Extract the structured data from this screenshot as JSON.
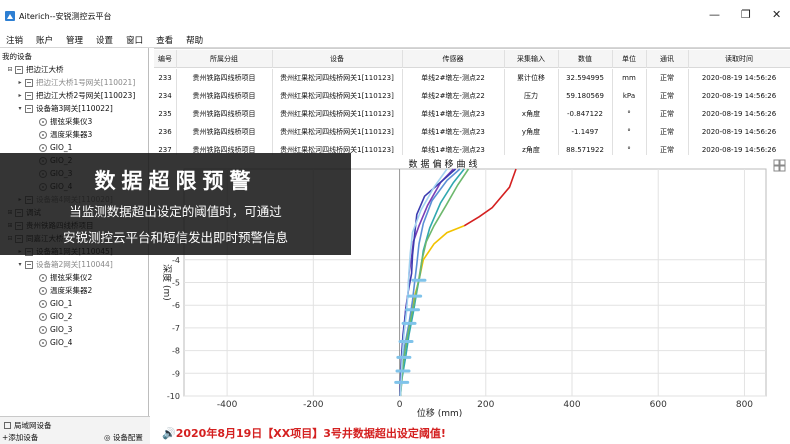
{
  "window": {
    "title": "Aiterich--安锐测控云平台",
    "controls": {
      "minimize": "—",
      "restore": "❐",
      "close": "✕"
    }
  },
  "menu": [
    "注销",
    "账户",
    "管理",
    "设置",
    "窗口",
    "查看",
    "帮助"
  ],
  "tree": {
    "root": "我的设备",
    "nodes": [
      {
        "label": "把边江大桥",
        "level": 1,
        "icon": "folder-icon",
        "toggle": "⊟"
      },
      {
        "label": "把边江大桥1号网关[110021]",
        "level": 2,
        "icon": "folder-icon",
        "toggle": "▸",
        "faded": true
      },
      {
        "label": "把边江大桥2号网关[110023]",
        "level": 2,
        "icon": "folder-icon",
        "toggle": "▸"
      },
      {
        "label": "设备箱3网关[110022]",
        "level": 2,
        "icon": "folder-icon",
        "toggle": "▾"
      },
      {
        "label": "振弦采集仪3",
        "level": 3,
        "icon": "gauge-icon"
      },
      {
        "label": "温度采集器3",
        "level": 3,
        "icon": "gauge-icon"
      },
      {
        "label": "GIO_1",
        "level": 3,
        "icon": "gauge-icon"
      },
      {
        "label": "GIO_2",
        "level": 3,
        "icon": "gauge-icon"
      },
      {
        "label": "GIO_3",
        "level": 3,
        "icon": "gauge-icon"
      },
      {
        "label": "GIO_4",
        "level": 3,
        "icon": "gauge-icon"
      },
      {
        "label": "设备箱4网关[110020]",
        "level": 2,
        "icon": "folder-icon",
        "toggle": "▸",
        "faded": true
      },
      {
        "label": "调试",
        "level": 1,
        "icon": "folder-icon",
        "toggle": "⊞"
      },
      {
        "label": "贵州铁路四线桥项目",
        "level": 1,
        "icon": "folder-icon",
        "toggle": "⊞"
      },
      {
        "label": "同嘉江大桥",
        "level": 1,
        "icon": "folder-icon",
        "toggle": "⊟"
      },
      {
        "label": "设备箱1网关[110045]",
        "level": 2,
        "icon": "folder-icon",
        "toggle": "▸"
      },
      {
        "label": "设备箱2网关[110044]",
        "level": 2,
        "icon": "folder-icon",
        "toggle": "▾",
        "faded": true
      },
      {
        "label": "振弦采集仪2",
        "level": 3,
        "icon": "gauge-icon"
      },
      {
        "label": "温度采集器2",
        "level": 3,
        "icon": "gauge-icon"
      },
      {
        "label": "GIO_1",
        "level": 3,
        "icon": "gauge-icon"
      },
      {
        "label": "GIO_2",
        "level": 3,
        "icon": "gauge-icon"
      },
      {
        "label": "GIO_3",
        "level": 3,
        "icon": "gauge-icon"
      },
      {
        "label": "GIO_4",
        "level": 3,
        "icon": "gauge-icon"
      }
    ]
  },
  "bottom_tabs": {
    "network": "局域网设备",
    "add_device": "+添加设备",
    "device_config": "◎ 设备配置"
  },
  "table": {
    "headers": [
      "编号",
      "所属分组",
      "设备",
      "传感器",
      "采集输入",
      "数值",
      "单位",
      "通讯",
      "读取时间"
    ],
    "rows": [
      [
        "233",
        "贵州铁路四线桥项目",
        "贵州红果松河四线桥网关1[110123]",
        "单线2#墩左-测点22",
        "累计位移",
        "32.594995",
        "mm",
        "正常",
        "2020-08-19 14:56:26"
      ],
      [
        "234",
        "贵州铁路四线桥项目",
        "贵州红果松河四线桥网关1[110123]",
        "单线2#墩左-测点22",
        "压力",
        "59.180569",
        "kPa",
        "正常",
        "2020-08-19 14:56:26"
      ],
      [
        "235",
        "贵州铁路四线桥项目",
        "贵州红果松河四线桥网关1[110123]",
        "单线1#墩左-测点23",
        "x角度",
        "-0.847122",
        "°",
        "正常",
        "2020-08-19 14:56:26"
      ],
      [
        "236",
        "贵州铁路四线桥项目",
        "贵州红果松河四线桥网关1[110123]",
        "单线1#墩左-测点23",
        "y角度",
        "-1.1497",
        "°",
        "正常",
        "2020-08-19 14:56:26"
      ],
      [
        "237",
        "贵州铁路四线桥项目",
        "贵州红果松河四线桥网关1[110123]",
        "单线1#墩左-测点23",
        "z角度",
        "88.571922",
        "°",
        "正常",
        "2020-08-19 14:56:26"
      ]
    ]
  },
  "overlay": {
    "headline": "数据超限预警",
    "line1": "当监测数据超出设定的阈值时，可通过",
    "line2": "安锐测控云平台和短信发出即时预警信息"
  },
  "alarm": {
    "prefix": "🔊",
    "text": "2020年8月19日【XX项目】3号井数据超出设定阈值!"
  },
  "chart_data": {
    "type": "line",
    "title": "数据偏移曲线",
    "xlabel": "位移 (mm)",
    "ylabel": "深度 (m)",
    "xlim": [
      -500,
      310
    ],
    "ylim": [
      -10,
      0
    ],
    "xticks": [
      -400,
      -200,
      0,
      200,
      400,
      600,
      800
    ],
    "yticks": [
      -4,
      -5,
      -6,
      -7,
      -8,
      -9,
      -10
    ],
    "series": [
      {
        "color": "#d42020",
        "points": [
          [
            270,
            0
          ],
          [
            255,
            -0.8
          ],
          [
            215,
            -1.7
          ],
          [
            185,
            -2.1
          ],
          [
            150,
            -2.5
          ]
        ]
      },
      {
        "color": "#f2c200",
        "points": [
          [
            150,
            -2.5
          ],
          [
            110,
            -2.8
          ],
          [
            80,
            -3.3
          ],
          [
            55,
            -4.0
          ],
          [
            45,
            -4.9
          ],
          [
            35,
            -5.6
          ],
          [
            28,
            -6.4
          ],
          [
            20,
            -7.3
          ],
          [
            10,
            -8.2
          ],
          [
            5,
            -9.1
          ],
          [
            2,
            -10
          ]
        ]
      },
      {
        "color": "#7a3fb8",
        "points": [
          [
            125,
            0
          ],
          [
            95,
            -0.6
          ],
          [
            65,
            -1.6
          ],
          [
            45,
            -2.5
          ],
          [
            32,
            -3.2
          ],
          [
            28,
            -3.9
          ],
          [
            22,
            -4.6
          ],
          [
            20,
            -5.4
          ],
          [
            14,
            -6.2
          ],
          [
            10,
            -7.2
          ],
          [
            5,
            -8.3
          ],
          [
            2,
            -10
          ]
        ]
      },
      {
        "color": "#5b8fd6",
        "points": [
          [
            140,
            0
          ],
          [
            110,
            -0.5
          ],
          [
            75,
            -1.4
          ],
          [
            55,
            -2.4
          ],
          [
            45,
            -3.3
          ],
          [
            40,
            -4.2
          ],
          [
            35,
            -5.0
          ],
          [
            30,
            -5.8
          ],
          [
            22,
            -6.8
          ],
          [
            12,
            -7.8
          ],
          [
            5,
            -9.0
          ],
          [
            1,
            -10
          ]
        ]
      },
      {
        "color": "#30a8b0",
        "points": [
          [
            150,
            0
          ],
          [
            125,
            -0.6
          ],
          [
            95,
            -1.5
          ],
          [
            70,
            -2.6
          ],
          [
            55,
            -3.6
          ],
          [
            48,
            -4.6
          ],
          [
            40,
            -5.4
          ],
          [
            32,
            -6.3
          ],
          [
            22,
            -7.3
          ],
          [
            14,
            -8.3
          ],
          [
            6,
            -9.2
          ],
          [
            2,
            -10
          ]
        ]
      },
      {
        "color": "#3b3bb0",
        "points": [
          [
            130,
            0
          ],
          [
            100,
            -0.5
          ],
          [
            58,
            -1.2
          ],
          [
            40,
            -2.0
          ],
          [
            35,
            -2.9
          ],
          [
            30,
            -3.8
          ],
          [
            28,
            -4.6
          ],
          [
            20,
            -5.4
          ],
          [
            14,
            -6.3
          ],
          [
            8,
            -7.3
          ],
          [
            4,
            -8.4
          ],
          [
            1,
            -10
          ]
        ]
      },
      {
        "color": "#6db86d",
        "points": [
          [
            160,
            0
          ],
          [
            135,
            -0.7
          ],
          [
            108,
            -1.6
          ],
          [
            80,
            -2.5
          ],
          [
            62,
            -3.2
          ],
          [
            52,
            -4.0
          ],
          [
            45,
            -4.8
          ],
          [
            36,
            -5.7
          ],
          [
            26,
            -6.6
          ],
          [
            16,
            -7.6
          ],
          [
            8,
            -8.6
          ],
          [
            2,
            -10
          ]
        ]
      },
      {
        "color": "#a3d3f0",
        "points": [
          [
            110,
            0
          ],
          [
            80,
            -0.8
          ],
          [
            50,
            -1.8
          ],
          [
            30,
            -2.8
          ],
          [
            25,
            -3.7
          ],
          [
            22,
            -4.5
          ],
          [
            20,
            -5.3
          ],
          [
            16,
            -6.3
          ],
          [
            10,
            -7.3
          ],
          [
            6,
            -8.4
          ],
          [
            2,
            -10
          ]
        ]
      }
    ],
    "markers": [
      {
        "color": "#7fc3ea",
        "points": [
          [
            45,
            -4.9
          ],
          [
            35,
            -5.6
          ],
          [
            30,
            -6.2
          ],
          [
            22,
            -6.8
          ],
          [
            15,
            -7.6
          ],
          [
            10,
            -8.3
          ],
          [
            8,
            -8.9
          ],
          [
            5,
            -9.4
          ]
        ]
      }
    ],
    "grid": true
  }
}
